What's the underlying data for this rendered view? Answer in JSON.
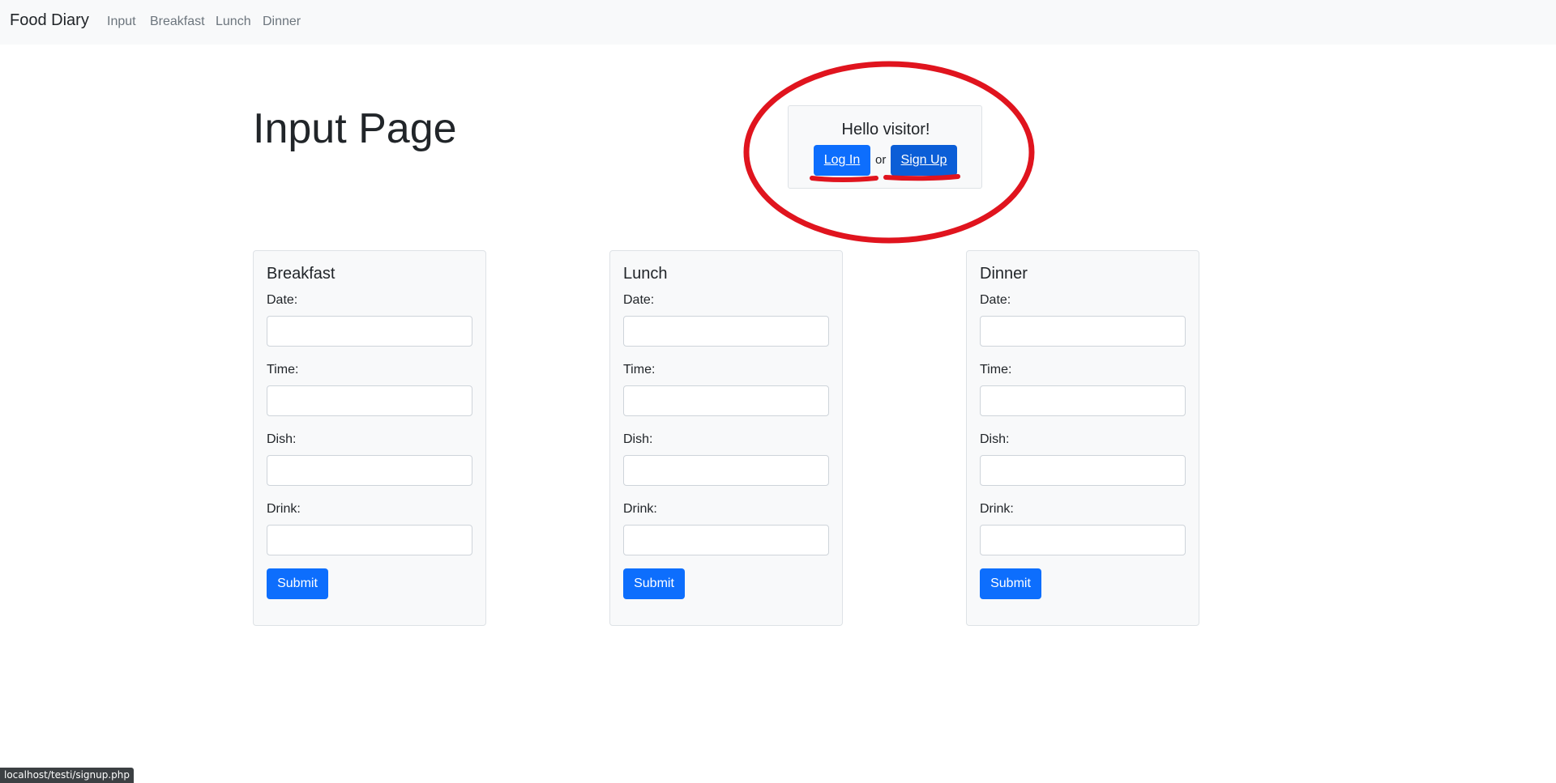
{
  "navbar": {
    "brand": "Food Diary",
    "links": [
      "Input",
      "Breakfast",
      "Lunch",
      "Dinner"
    ]
  },
  "page": {
    "title": "Input Page"
  },
  "auth": {
    "greeting": "Hello visitor!",
    "login_label": "Log In",
    "separator": "or",
    "signup_label": "Sign Up"
  },
  "cards": [
    {
      "title": "Breakfast",
      "labels": [
        "Date:",
        "Time:",
        "Dish:",
        "Drink:"
      ],
      "values": [
        "",
        "",
        "",
        ""
      ],
      "submit_label": "Submit"
    },
    {
      "title": "Lunch",
      "labels": [
        "Date:",
        "Time:",
        "Dish:",
        "Drink:"
      ],
      "values": [
        "",
        "",
        "",
        ""
      ],
      "submit_label": "Submit"
    },
    {
      "title": "Dinner",
      "labels": [
        "Date:",
        "Time:",
        "Dish:",
        "Drink:"
      ],
      "values": [
        "",
        "",
        "",
        ""
      ],
      "submit_label": "Submit"
    }
  ],
  "status_bar": {
    "url": "localhost/testi/signup.php"
  },
  "colors": {
    "primary": "#0d6efd",
    "annotation": "#e0141e",
    "navbar_bg": "#f8f9fa"
  }
}
